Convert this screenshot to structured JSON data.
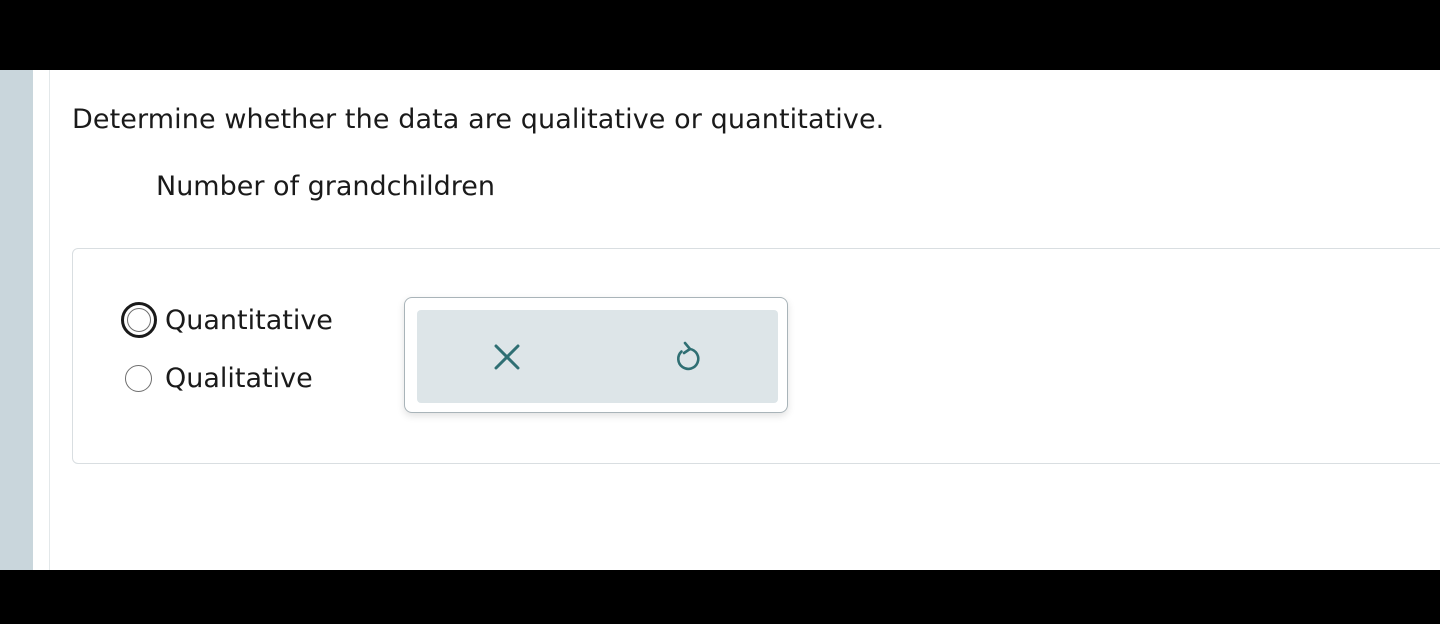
{
  "question": {
    "prompt": "Determine whether the data are qualitative or quantitative.",
    "subject": "Number of grandchildren"
  },
  "options": [
    {
      "label": "Quantitative",
      "selected": false,
      "focused": true
    },
    {
      "label": "Qualitative",
      "selected": false,
      "focused": false
    }
  ],
  "tools": {
    "clear_icon": "close-icon",
    "reset_icon": "undo-icon"
  },
  "colors": {
    "side_strip": "#c9d6dc",
    "tools_background": "#dde5e8",
    "icon": "#2f6f73"
  }
}
